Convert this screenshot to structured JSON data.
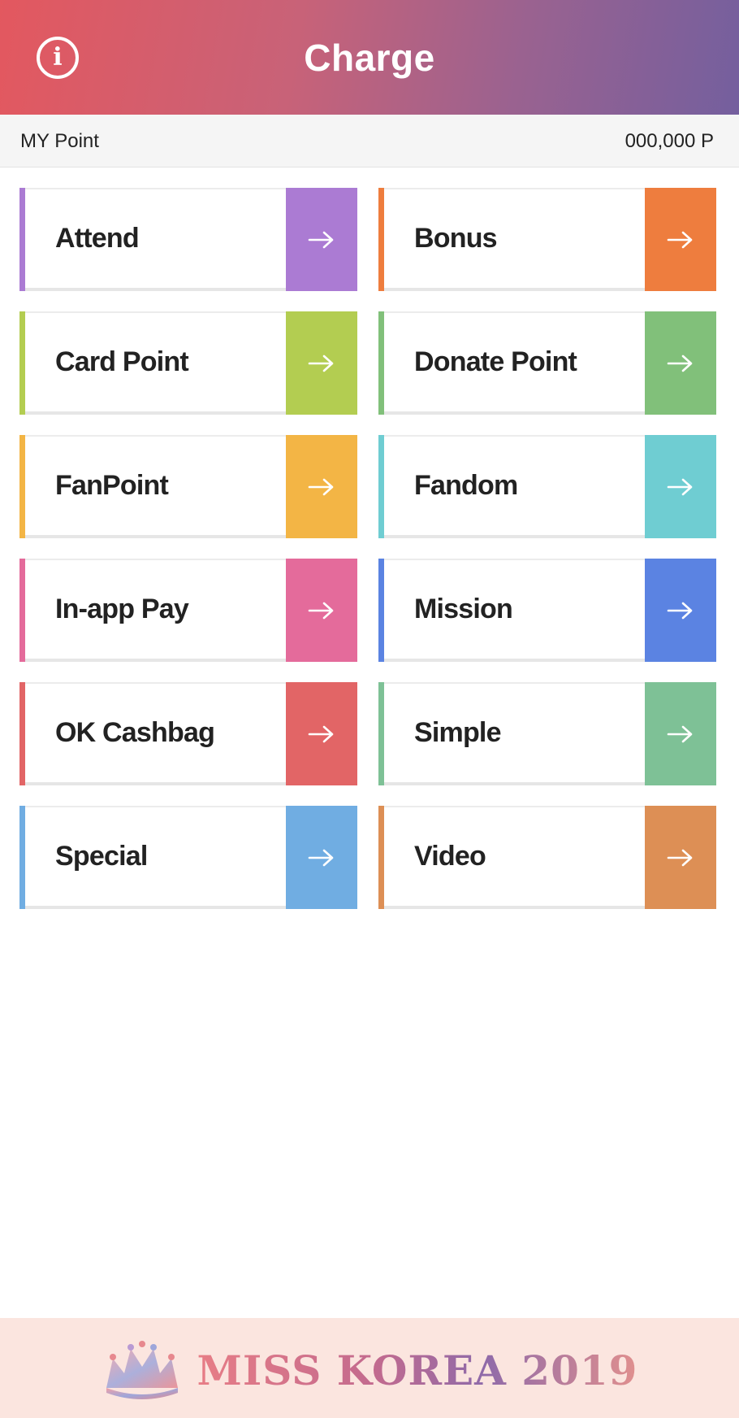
{
  "header": {
    "title": "Charge",
    "info_icon": "info-icon"
  },
  "my_point": {
    "label": "MY Point",
    "value": "000,000 P"
  },
  "menu": [
    {
      "label": "Attend",
      "color": "#ab7bd3",
      "icon": "arrow-right-icon"
    },
    {
      "label": "Bonus",
      "color": "#ee7d3e",
      "icon": "arrow-right-icon"
    },
    {
      "label": "Card Point",
      "color": "#b3cd51",
      "icon": "arrow-right-icon"
    },
    {
      "label": "Donate Point",
      "color": "#81c07a",
      "icon": "arrow-right-icon"
    },
    {
      "label": "FanPoint",
      "color": "#f3b545",
      "icon": "arrow-right-icon"
    },
    {
      "label": "Fandom",
      "color": "#6fcdd2",
      "icon": "arrow-right-icon"
    },
    {
      "label": "In-app Pay",
      "color": "#e46b9b",
      "icon": "arrow-right-icon"
    },
    {
      "label": "Mission",
      "color": "#5b83e2",
      "icon": "arrow-right-icon"
    },
    {
      "label": "OK Cashbag",
      "color": "#e26566",
      "icon": "arrow-right-icon"
    },
    {
      "label": "Simple",
      "color": "#7ec196",
      "icon": "arrow-right-icon"
    },
    {
      "label": "Special",
      "color": "#70ade2",
      "icon": "arrow-right-icon"
    },
    {
      "label": "Video",
      "color": "#dd8f55",
      "icon": "arrow-right-icon"
    }
  ],
  "footer": {
    "brand": "MISS KOREA 2019",
    "logo_icon": "crown-icon",
    "background": "#fbe5df"
  },
  "colors": {
    "header_gradient_start": "#e3585f",
    "header_gradient_end": "#745f9e"
  }
}
